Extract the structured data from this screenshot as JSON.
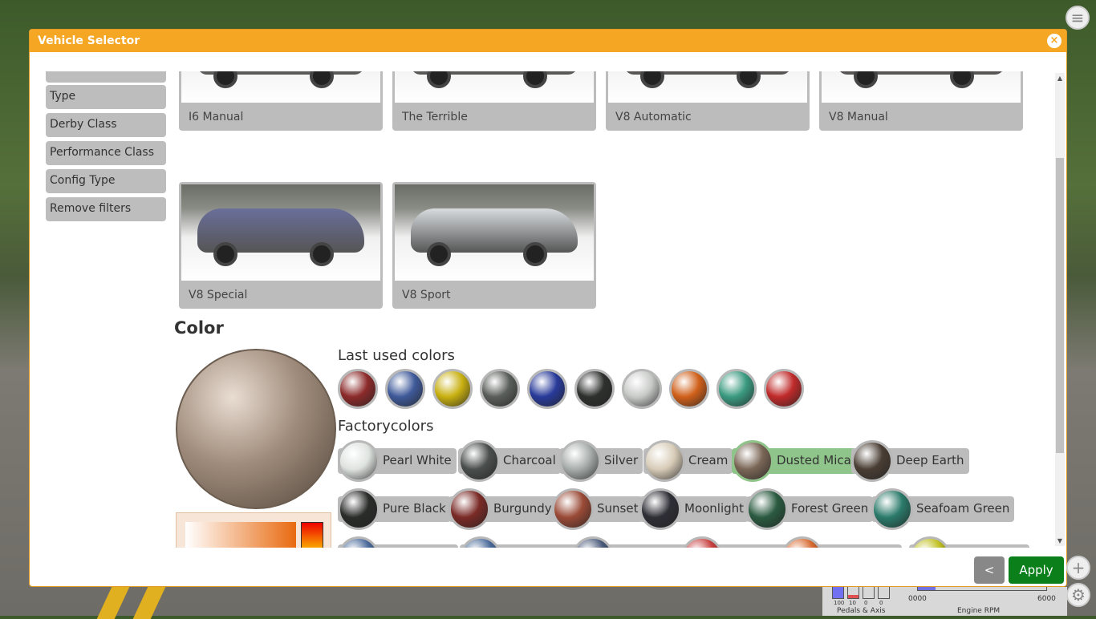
{
  "window": {
    "title": "Vehicle Selector",
    "close_icon": "×"
  },
  "filters": [
    "Type",
    "Derby Class",
    "Performance Class",
    "Config Type",
    "Remove filters"
  ],
  "configs": [
    {
      "label": "I6 Manual",
      "color": "#e2d8c6"
    },
    {
      "label": "The Terrible",
      "color": "#cdb8a6"
    },
    {
      "label": "V8 Automatic",
      "color": "#b25a58"
    },
    {
      "label": "V8 Manual",
      "color": "#b05a56"
    },
    {
      "label": "V8 Special",
      "color": "#6a6f9a"
    },
    {
      "label": "V8 Sport",
      "color": "#d8dcdf"
    }
  ],
  "color_section": {
    "title": "Color",
    "last_used_title": "Last used colors",
    "factory_title": "Factorycolors"
  },
  "last_used": [
    "#8c2a2a",
    "#3f5a9a",
    "#c8b010",
    "#5a5e5a",
    "#283a9a",
    "#2e302e",
    "#c8cac8",
    "#d0601a",
    "#3a9a80",
    "#c02a2a"
  ],
  "factory": [
    {
      "name": "Pearl White",
      "color": "#dfe3e0"
    },
    {
      "name": "Charcoal",
      "color": "#4a4e4c"
    },
    {
      "name": "Silver",
      "color": "#a8aeac"
    },
    {
      "name": "Cream",
      "color": "#d8ccb8"
    },
    {
      "name": "Dusted Mica",
      "color": "#7a6656",
      "selected": true
    },
    {
      "name": "Deep Earth",
      "color": "#4a3e34"
    },
    {
      "name": "Pure Black",
      "color": "#2a2c2a"
    },
    {
      "name": "Burgundy",
      "color": "#7a2a26"
    },
    {
      "name": "Sunset",
      "color": "#9a4a36"
    },
    {
      "name": "Moonlight",
      "color": "#2e2e36"
    },
    {
      "name": "Forest Green",
      "color": "#2a5a40"
    },
    {
      "name": "Seafoam Green",
      "color": "#2a7a6a"
    }
  ],
  "factory_partial": [
    "#4a6a9a",
    "#4a6a9a",
    "#4a5a7a",
    "#c84040",
    "#d86a30",
    "#c0c020"
  ],
  "buttons": {
    "back": "<",
    "apply": "Apply"
  },
  "hud": {
    "pedal_values": [
      "100",
      "10",
      "0",
      "0"
    ],
    "pedals_label": "Pedals & Axis",
    "rpm_min": "0000",
    "rpm_max": "6000",
    "rpm_label": "Engine RPM"
  }
}
